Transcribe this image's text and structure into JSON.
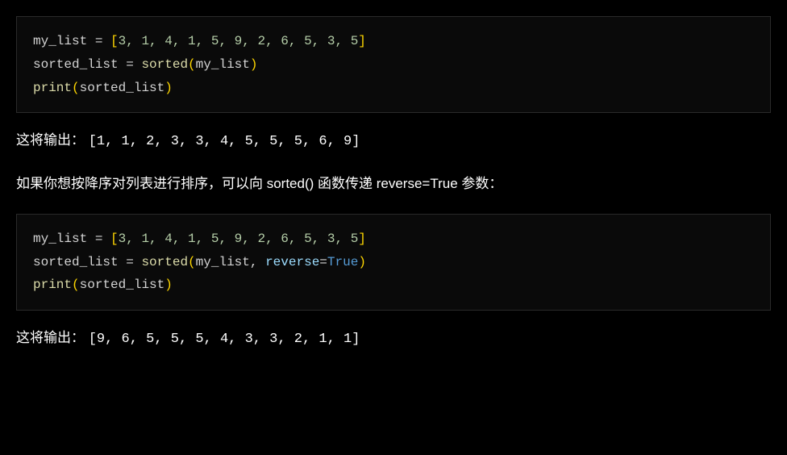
{
  "code1": {
    "line1": {
      "var": "my_list",
      "op": " = ",
      "bracket_open": "[",
      "nums": "3, 1, 4, 1, 5, 9, 2, 6, 5, 3, 5",
      "bracket_close": "]"
    },
    "line2": {
      "var": "sorted_list",
      "op": " = ",
      "func": "sorted",
      "paren_open": "(",
      "arg": "my_list",
      "paren_close": ")"
    },
    "line3": {
      "func": "print",
      "paren_open": "(",
      "arg": "sorted_list",
      "paren_close": ")"
    }
  },
  "para1": {
    "prefix": "这将输出：  ",
    "output": "[1, 1, 2, 3, 3, 4, 5, 5, 5, 6, 9]"
  },
  "para2": {
    "text": "如果你想按降序对列表进行排序，可以向 sorted() 函数传递 reverse=True 参数："
  },
  "code2": {
    "line1": {
      "var": "my_list",
      "op": " = ",
      "bracket_open": "[",
      "nums": "3, 1, 4, 1, 5, 9, 2, 6, 5, 3, 5",
      "bracket_close": "]"
    },
    "line2": {
      "var": "sorted_list",
      "op": " = ",
      "func": "sorted",
      "paren_open": "(",
      "arg": "my_list",
      "comma": ", ",
      "param": "reverse",
      "eq": "=",
      "bool": "True",
      "paren_close": ")"
    },
    "line3": {
      "func": "print",
      "paren_open": "(",
      "arg": "sorted_list",
      "paren_close": ")"
    }
  },
  "para3": {
    "prefix": "这将输出： ",
    "output": "[9, 6, 5, 5, 5, 4, 3, 3, 2, 1, 1]"
  }
}
